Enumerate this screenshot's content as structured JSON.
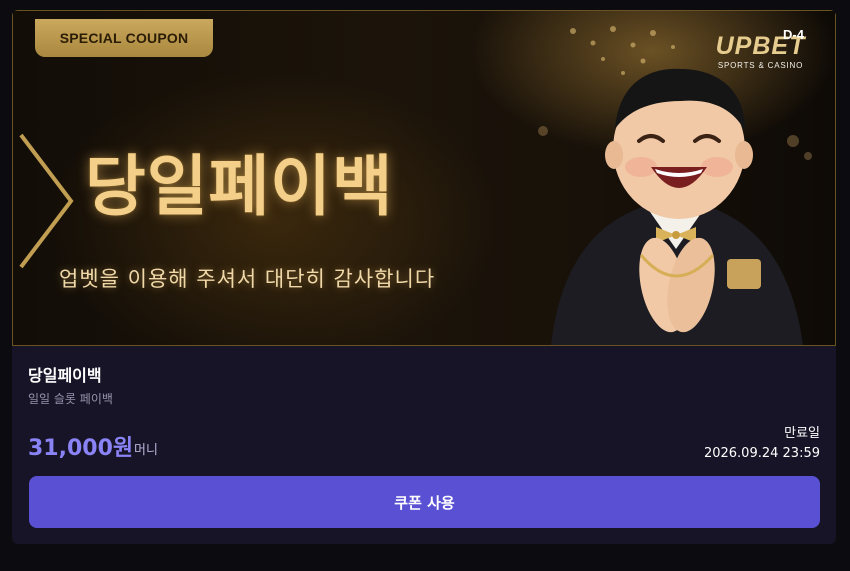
{
  "banner": {
    "badge": "SPECIAL COUPON",
    "brand_name": "UPBET",
    "brand_sub": "SPORTS & CASINO",
    "dday": "D-4",
    "headline": "당일페이백",
    "tagline": "업벳을 이용해 주셔서 대단히 감사합니다"
  },
  "coupon": {
    "title": "당일페이백",
    "subtitle": "일일 슬롯 페이백",
    "amount": "31,000원",
    "unit": "머니",
    "expiry_label": "만료일",
    "expiry_date": "2026.09.24 23:59",
    "use_button": "쿠폰 사용"
  },
  "colors": {
    "accent": "#5a50d4",
    "amount": "#8a83f5",
    "gold": "#f3cf8a",
    "card_bg": "#161426"
  }
}
